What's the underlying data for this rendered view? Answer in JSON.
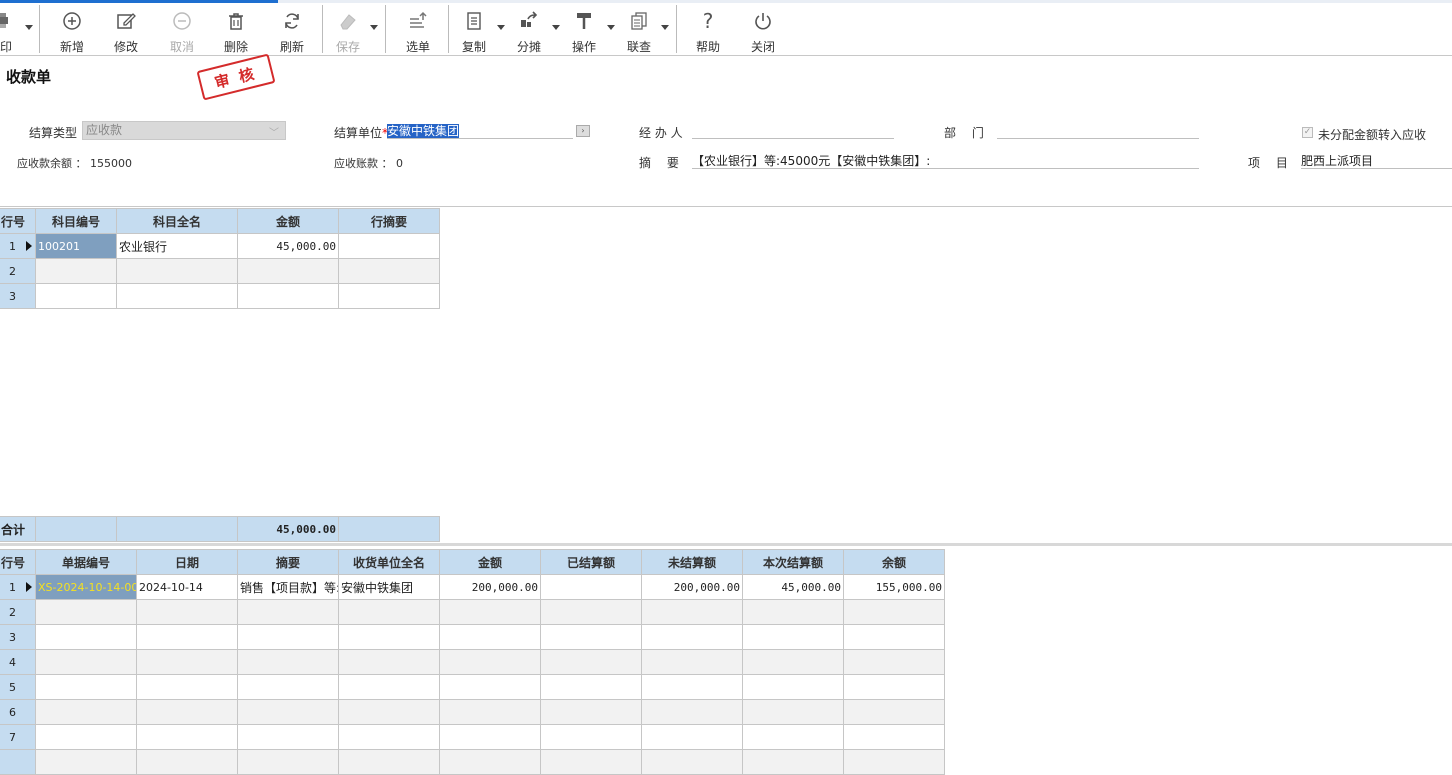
{
  "toolbar": {
    "print": "印",
    "add": "新增",
    "edit": "修改",
    "cancel": "取消",
    "delete": "删除",
    "refresh": "刷新",
    "save": "保存",
    "select": "选单",
    "copy": "复制",
    "split": "分摊",
    "operate": "操作",
    "query": "联查",
    "help": "帮助",
    "close": "关闭"
  },
  "form": {
    "title": "收款单",
    "stamp": "审核",
    "settle_type_label": "结算类型",
    "settle_type_value": "应收款",
    "settle_unit_label": "结算单位",
    "settle_unit_required": "*",
    "settle_unit_value": "安徽中铁集团",
    "handler_label": "经 办 人",
    "handler_value": "",
    "dept_label": "部　 门",
    "dept_value": "",
    "unallocated_label": "未分配金额转入应收",
    "receivable_balance_label": "应收款余额 ：",
    "receivable_balance_value": "155000",
    "receivable_account_label": "应收账款 ：",
    "receivable_account_value": "0",
    "summary_label": "摘　 要",
    "summary_value": "【农业银行】等:45000元【安徽中铁集团】:",
    "project_label": "项　 目",
    "project_value": "肥西上派项目"
  },
  "top_table": {
    "headers": [
      "行号",
      "科目编号",
      "科目全名",
      "金额",
      "行摘要"
    ],
    "rows": [
      {
        "no": "1",
        "code": "100201",
        "name": "农业银行",
        "amount": "45,000.00",
        "memo": ""
      },
      {
        "no": "2",
        "code": "",
        "name": "",
        "amount": "",
        "memo": ""
      },
      {
        "no": "3",
        "code": "",
        "name": "",
        "amount": "",
        "memo": ""
      }
    ],
    "total_label": "合计",
    "total_amount": "45,000.00"
  },
  "bottom_table": {
    "headers": [
      "行号",
      "单据编号",
      "日期",
      "摘要",
      "收货单位全名",
      "金额",
      "已结算额",
      "未结算额",
      "本次结算额",
      "余额"
    ],
    "rows": [
      {
        "no": "1",
        "bill": "XS-2024-10-14-00",
        "date": "2024-10-14",
        "summary": "销售【项目款】等:",
        "unit": "安徽中铁集团",
        "amount": "200,000.00",
        "settled": "",
        "unsettled": "200,000.00",
        "current": "45,000.00",
        "balance": "155,000.00"
      },
      {
        "no": "2"
      },
      {
        "no": "3"
      },
      {
        "no": "4"
      },
      {
        "no": "5"
      },
      {
        "no": "6"
      },
      {
        "no": "7"
      },
      {
        "no": ""
      }
    ]
  }
}
